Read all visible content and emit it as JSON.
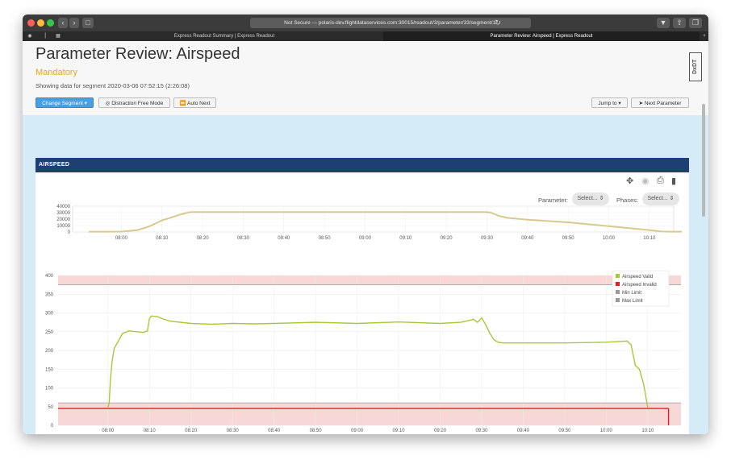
{
  "browser": {
    "url": "Not Secure — polaris-dev.flightdataservices.com:30015/readout/3/parameter/33/segment/1/",
    "tabs": [
      {
        "label": "Express Readout Summary | Express Readout",
        "active": false
      },
      {
        "label": "Parameter Review: Airspeed | Express Readout",
        "active": true
      }
    ]
  },
  "header": {
    "title": "Parameter Review: Airspeed",
    "subtitle": "Mandatory",
    "segment_info": "Showing data for segment 2020-03-06 07:52:15 (2:26:08)",
    "logo_text": "DxDT"
  },
  "toolbar": {
    "change_segment": "Change Segment",
    "distraction_free": "Distraction Free Mode",
    "auto_next": "Auto Next",
    "jump_to": "Jump to",
    "next_parameter": "Next Parameter"
  },
  "panel": {
    "title": "AIRSPEED",
    "parameter_label": "Parameter:",
    "parameter_select": "Select...",
    "phases_label": "Phases:",
    "phases_select": "Select..."
  },
  "colors": {
    "header_bar": "#1d3f72",
    "valid": "#a8c83a",
    "invalid": "#e02020",
    "limit_fill": "#f8d7d7",
    "overview_line": "#d8c98f",
    "primary_button": "#4a9fe0",
    "subtitle": "#e6a817"
  },
  "chart_data": [
    {
      "type": "line",
      "name": "altitude-overview",
      "x_tick_labels": [
        "08:00",
        "08:10",
        "08:20",
        "08:30",
        "08:40",
        "08:50",
        "09:00",
        "09:10",
        "09:20",
        "09:30",
        "09:40",
        "09:50",
        "10:00",
        "10:10"
      ],
      "y_ticks": [
        0,
        10000,
        20000,
        30000,
        40000
      ],
      "ylim": [
        0,
        40000
      ],
      "x_unit": "minutes after 08:00",
      "series": [
        {
          "x": [
            -8,
            -4,
            0,
            4,
            7,
            9,
            10,
            12,
            15,
            17,
            18,
            90,
            91,
            93,
            95,
            100,
            110,
            120,
            130,
            133,
            135,
            138
          ],
          "y": [
            500,
            500,
            600,
            3000,
            9000,
            15000,
            18000,
            22000,
            28000,
            31000,
            31000,
            31000,
            30000,
            25000,
            22000,
            19000,
            15000,
            9000,
            3000,
            800,
            500,
            500
          ]
        }
      ]
    },
    {
      "type": "line",
      "name": "airspeed",
      "x_tick_labels": [
        "08:00",
        "08:10",
        "08:20",
        "08:30",
        "08:40",
        "08:50",
        "09:00",
        "09:10",
        "09:20",
        "09:30",
        "09:40",
        "09:50",
        "10:00",
        "10:10"
      ],
      "y_ticks": [
        0,
        50,
        100,
        150,
        200,
        250,
        300,
        350,
        400
      ],
      "ylim": [
        0,
        400
      ],
      "x_unit": "minutes after 08:00",
      "legend": [
        "Airspeed Valid",
        "Airspeed Invalid",
        "Min Limit",
        "Max Limit"
      ],
      "legend_position": "top-right",
      "min_limit": 60,
      "max_limit": 375,
      "series": [
        {
          "name": "Airspeed Valid",
          "x": [
            0,
            0.3,
            0.6,
            1,
            1.5,
            2.5,
            3.5,
            5,
            7,
            8.5,
            9.5,
            10,
            10.5,
            12,
            13,
            15,
            20,
            25,
            30,
            35,
            40,
            50,
            60,
            70,
            80,
            85,
            87,
            88,
            89,
            90,
            91,
            92,
            93,
            94,
            95,
            100,
            110,
            120,
            125,
            126,
            127,
            128,
            129,
            130
          ],
          "y": [
            48,
            60,
            120,
            170,
            205,
            225,
            245,
            252,
            250,
            248,
            252,
            285,
            292,
            290,
            285,
            278,
            272,
            270,
            272,
            271,
            272,
            275,
            272,
            276,
            272,
            275,
            280,
            283,
            275,
            287,
            268,
            245,
            228,
            222,
            220,
            220,
            220,
            222,
            225,
            215,
            160,
            150,
            110,
            48
          ]
        },
        {
          "name": "Airspeed Invalid",
          "x": [
            -12,
            0,
            130,
            135
          ],
          "y": [
            45,
            45,
            45,
            45
          ]
        }
      ]
    }
  ]
}
